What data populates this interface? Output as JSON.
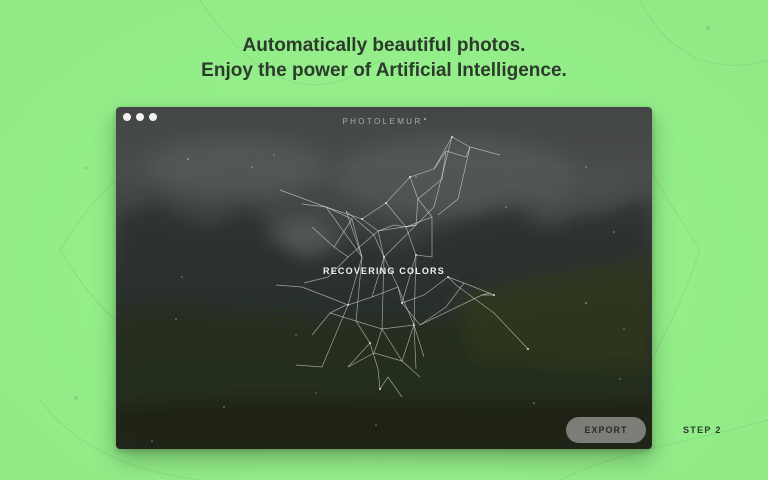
{
  "headline": {
    "line1": "Automatically beautiful photos.",
    "line2": "Enjoy the power of Artificial Intelligence."
  },
  "app_window": {
    "title": "PHOTOLEMUR",
    "status": "RECOVERING COLORS",
    "export_label": "EXPORT"
  },
  "step_label": "STEP 2",
  "colors": {
    "background": "#95f08b",
    "headline_text": "#2d3b2c",
    "window_top": "#4d5150",
    "window_bottom": "#232b1e",
    "export_button": "#c8c8c8",
    "mesh_lines": "#e6e6e6"
  },
  "icons": {
    "window_controls": [
      "window-dot-icon",
      "window-dot-icon",
      "window-dot-icon"
    ],
    "mesh": "wireframe-mesh-icon"
  }
}
